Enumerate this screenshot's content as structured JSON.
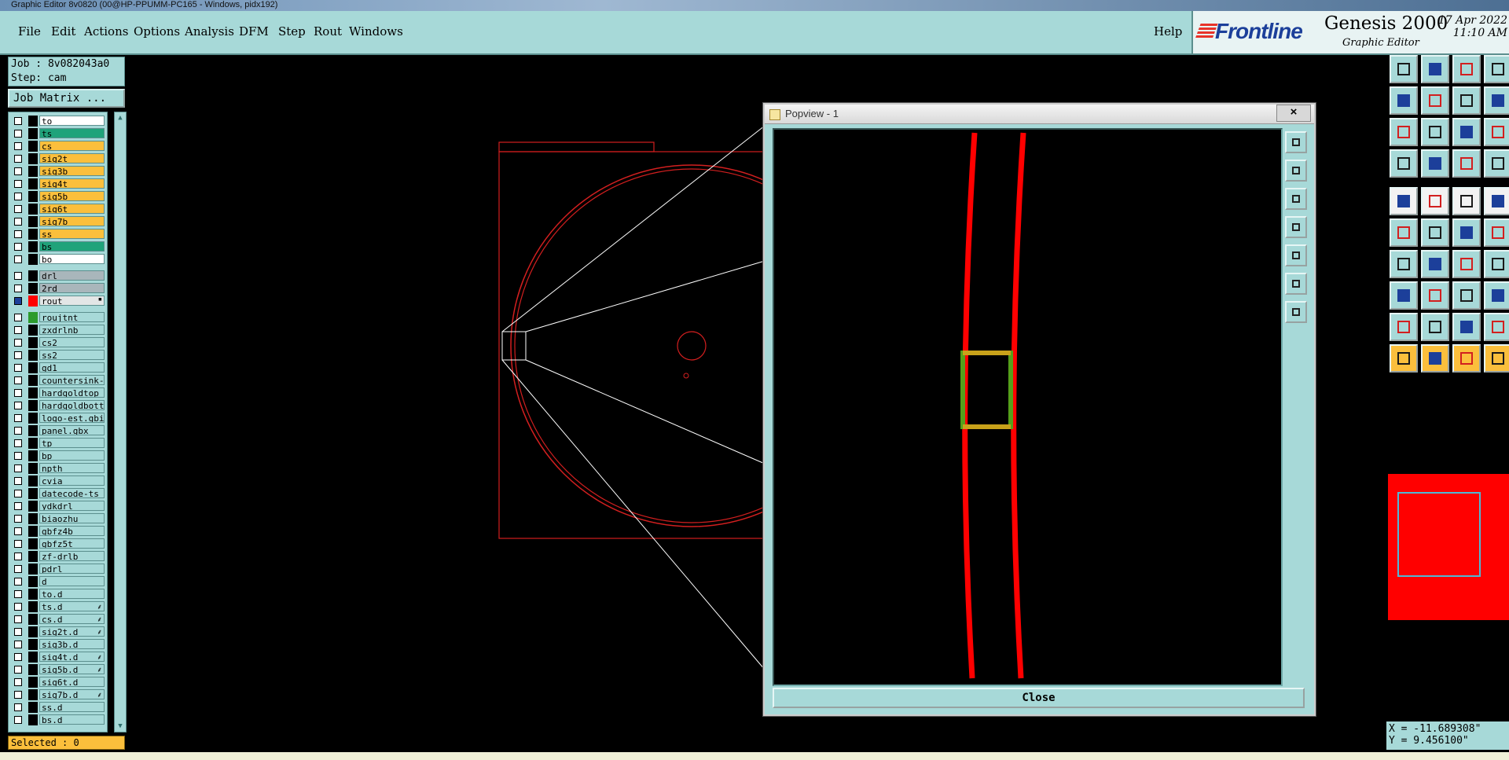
{
  "window": {
    "title": "Graphic Editor 8v0820 (00@HP-PPUMM-PC165 - Windows, pidx192)"
  },
  "menu": {
    "items": [
      "File",
      "Edit",
      "Actions",
      "Options",
      "Analysis",
      "DFM",
      "Step",
      "Rout",
      "Windows"
    ],
    "help": "Help"
  },
  "brand": {
    "logo": "Frontline",
    "product": "Genesis 2000",
    "subtitle": "Graphic Editor",
    "date": "17 Apr 2022",
    "time": "11:10 AM"
  },
  "job": {
    "job_line": "Job : 8v082043a0",
    "step_line": "Step: cam",
    "matrix_button": "Job Matrix ..."
  },
  "layers": [
    {
      "name": "to",
      "color": "#ffffff",
      "marker": ""
    },
    {
      "name": "ts",
      "color": "#1fa37a",
      "marker": ""
    },
    {
      "name": "cs",
      "color": "#fbbf3c",
      "marker": ""
    },
    {
      "name": "sig2t",
      "color": "#fbbf3c",
      "marker": ""
    },
    {
      "name": "sig3b",
      "color": "#fbbf3c",
      "marker": ""
    },
    {
      "name": "sig4t",
      "color": "#fbbf3c",
      "marker": ""
    },
    {
      "name": "sig5b",
      "color": "#fbbf3c",
      "marker": ""
    },
    {
      "name": "sig6t",
      "color": "#fbbf3c",
      "marker": ""
    },
    {
      "name": "sig7b",
      "color": "#fbbf3c",
      "marker": ""
    },
    {
      "name": "ss",
      "color": "#fbbf3c",
      "marker": ""
    },
    {
      "name": "bs",
      "color": "#1fa37a",
      "marker": ""
    },
    {
      "name": "bo",
      "color": "#ffffff",
      "marker": ""
    },
    {
      "name": "drl",
      "color": "#a9b6bb",
      "marker": ""
    },
    {
      "name": "2rd",
      "color": "#a9b6bb",
      "marker": ""
    },
    {
      "name": "rout",
      "color": "#e3e6e6",
      "marker": "▪"
    },
    {
      "name": "roujtnt",
      "color": "#a7d9d8",
      "marker": ""
    },
    {
      "name": "zxdrlnb",
      "color": "#a7d9d8",
      "marker": ""
    },
    {
      "name": "cs2",
      "color": "#a7d9d8",
      "marker": ""
    },
    {
      "name": "ss2",
      "color": "#a7d9d8",
      "marker": ""
    },
    {
      "name": "gd1",
      "color": "#a7d9d8",
      "marker": ""
    },
    {
      "name": "countersink-",
      "color": "#a7d9d8",
      "marker": ""
    },
    {
      "name": "hardgoldtop",
      "color": "#a7d9d8",
      "marker": ""
    },
    {
      "name": "hardgoldbott",
      "color": "#a7d9d8",
      "marker": ""
    },
    {
      "name": "logo-est.gbi",
      "color": "#a7d9d8",
      "marker": ""
    },
    {
      "name": "panel.gbx",
      "color": "#a7d9d8",
      "marker": ""
    },
    {
      "name": "tp",
      "color": "#a7d9d8",
      "marker": ""
    },
    {
      "name": "bp",
      "color": "#a7d9d8",
      "marker": ""
    },
    {
      "name": "npth",
      "color": "#a7d9d8",
      "marker": ""
    },
    {
      "name": "cvia",
      "color": "#a7d9d8",
      "marker": ""
    },
    {
      "name": "datecode-ts",
      "color": "#a7d9d8",
      "marker": ""
    },
    {
      "name": "ydkdrl",
      "color": "#a7d9d8",
      "marker": ""
    },
    {
      "name": "biaozhu",
      "color": "#a7d9d8",
      "marker": ""
    },
    {
      "name": "gbfz4b",
      "color": "#a7d9d8",
      "marker": ""
    },
    {
      "name": "gbfz5t",
      "color": "#a7d9d8",
      "marker": ""
    },
    {
      "name": "zf-drlb",
      "color": "#a7d9d8",
      "marker": ""
    },
    {
      "name": "pdrl",
      "color": "#a7d9d8",
      "marker": ""
    },
    {
      "name": "d",
      "color": "#a7d9d8",
      "marker": ""
    },
    {
      "name": "to.d",
      "color": "#a7d9d8",
      "marker": ""
    },
    {
      "name": "ts.d",
      "color": "#a7d9d8",
      "marker": "⸙"
    },
    {
      "name": "cs.d",
      "color": "#a7d9d8",
      "marker": "⸙"
    },
    {
      "name": "sig2t.d",
      "color": "#a7d9d8",
      "marker": "⸙"
    },
    {
      "name": "sig3b.d",
      "color": "#a7d9d8",
      "marker": ""
    },
    {
      "name": "sig4t.d",
      "color": "#a7d9d8",
      "marker": "⸙"
    },
    {
      "name": "sig5b.d",
      "color": "#a7d9d8",
      "marker": "⸙"
    },
    {
      "name": "sig6t.d",
      "color": "#a7d9d8",
      "marker": ""
    },
    {
      "name": "sig7b.d",
      "color": "#a7d9d8",
      "marker": "⸙"
    },
    {
      "name": "ss.d",
      "color": "#a7d9d8",
      "marker": ""
    },
    {
      "name": "bs.d",
      "color": "#a7d9d8",
      "marker": ""
    }
  ],
  "selected_status": "Selected : 0",
  "popview": {
    "title": "Popview - 1",
    "close_x": "×",
    "close_button": "Close"
  },
  "coords": {
    "x": "X = -11.689308\"",
    "y": "Y = 9.456100\""
  },
  "colors": {
    "panel": "#a7d9d8",
    "accent_orange": "#fbbf3c",
    "feature_red": "#ff0000",
    "highlight_green": "#55a01a"
  }
}
